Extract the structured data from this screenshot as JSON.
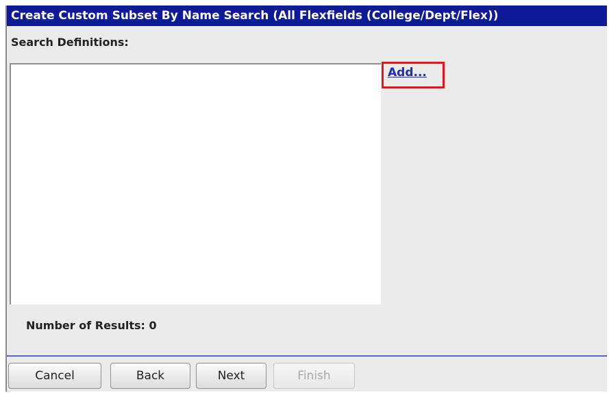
{
  "dialog": {
    "title": "Create Custom Subset By Name Search (All Flexfields (College/Dept/Flex))",
    "section_label": "Search Definitions:",
    "add_link": "Add...",
    "results_label": "Number of Results: 0"
  },
  "buttons": {
    "cancel": "Cancel",
    "back": "Back",
    "next": "Next",
    "finish": "Finish"
  },
  "colors": {
    "title_bg": "#0f1a98",
    "highlight": "#e8141b",
    "link": "#1f2fb5"
  }
}
